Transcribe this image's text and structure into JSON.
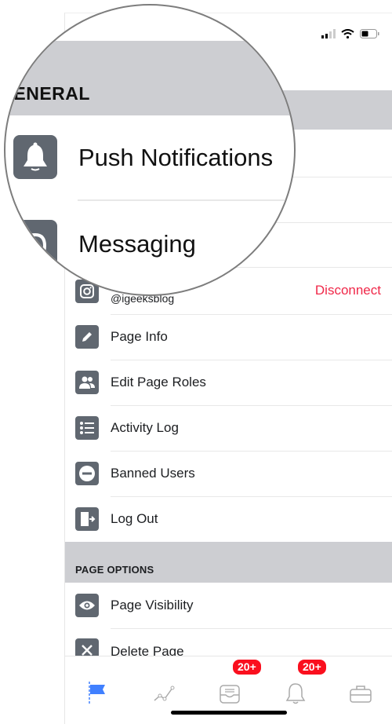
{
  "status_bar": {
    "signal_icon": "cellular-signal-icon",
    "wifi_icon": "wifi-icon",
    "battery_icon": "battery-icon"
  },
  "sections": {
    "general": {
      "header": "GENERAL",
      "items": [
        {
          "label": "Push Notifications",
          "icon": "bell-icon"
        },
        {
          "label": "Messaging",
          "icon": "messenger-icon"
        }
      ]
    },
    "instagram": {
      "handle": "@igeeksblog",
      "action": "Disconnect",
      "icon": "instagram-icon"
    },
    "items": [
      {
        "label": "Page Info",
        "icon": "pencil-icon"
      },
      {
        "label": "Edit Page Roles",
        "icon": "people-icon"
      },
      {
        "label": "Activity Log",
        "icon": "list-icon"
      },
      {
        "label": "Banned Users",
        "icon": "ban-icon"
      },
      {
        "label": "Log Out",
        "icon": "logout-icon"
      }
    ],
    "page_options": {
      "header": "PAGE OPTIONS",
      "items": [
        {
          "label": "Page Visibility",
          "icon": "eye-icon"
        },
        {
          "label": "Delete Page",
          "icon": "close-icon"
        }
      ]
    }
  },
  "tab_bar": {
    "tabs": [
      {
        "name": "page",
        "icon": "flag-icon",
        "active": true
      },
      {
        "name": "insights",
        "icon": "chart-line-icon"
      },
      {
        "name": "inbox",
        "icon": "inbox-icon",
        "badge": "20+"
      },
      {
        "name": "notifications",
        "icon": "bell-icon",
        "badge": "20+"
      },
      {
        "name": "tools",
        "icon": "briefcase-icon"
      }
    ]
  },
  "colors": {
    "accent": "#4080ff",
    "destructive": "#f02849",
    "icon_bg": "#606770",
    "section_bg": "#cdced2",
    "badge": "#fa0f1e"
  }
}
